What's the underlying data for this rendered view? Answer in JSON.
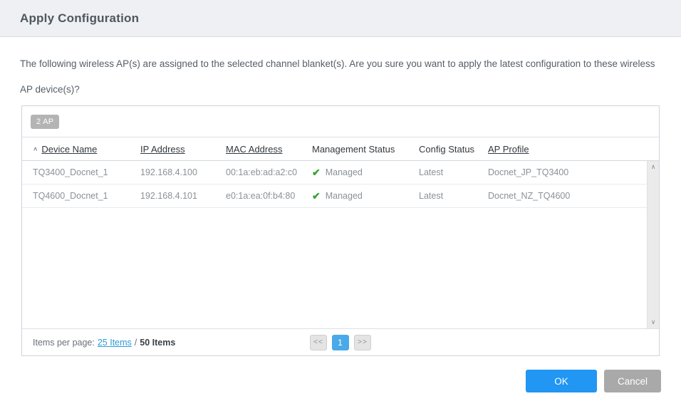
{
  "header": {
    "title": "Apply Configuration"
  },
  "description": "The following wireless AP(s) are assigned to the selected channel blanket(s). Are you sure you want to apply the latest configuration to these wireless AP device(s)?",
  "table": {
    "count_badge": "2 AP",
    "columns": [
      {
        "label": "Device Name"
      },
      {
        "label": "IP Address"
      },
      {
        "label": "MAC Address"
      },
      {
        "label": "Management Status"
      },
      {
        "label": "Config Status"
      },
      {
        "label": "AP Profile"
      }
    ],
    "rows": [
      {
        "device_name": "TQ3400_Docnet_1",
        "ip_address": "192.168.4.100",
        "mac_address": "00:1a:eb:ad:a2:c0",
        "management_status": "Managed",
        "config_status": "Latest",
        "ap_profile": "Docnet_JP_TQ3400"
      },
      {
        "device_name": "TQ4600_Docnet_1",
        "ip_address": "192.168.4.101",
        "mac_address": "e0:1a:ea:0f:b4:80",
        "management_status": "Managed",
        "config_status": "Latest",
        "ap_profile": "Docnet_NZ_TQ4600"
      }
    ]
  },
  "pagination": {
    "items_per_page_label": "Items per page:",
    "items_per_page_link": "25 Items",
    "separator": "/",
    "total_items": "50 Items",
    "prev_label": "<<",
    "current_page": "1",
    "next_label": ">>"
  },
  "footer": {
    "ok_label": "OK",
    "cancel_label": "Cancel"
  },
  "icons": {
    "sort_asc": "∧",
    "managed_check": "✔",
    "scroll_up": "∧",
    "scroll_down": "∨"
  },
  "colors": {
    "accent_blue": "#2196f3",
    "managed_green": "#33a532",
    "cancel_gray": "#a9a9a9",
    "badge_gray": "#b4b4b4",
    "active_page_blue": "#4aa9e9",
    "titlebar_bg": "#eef0f3"
  }
}
